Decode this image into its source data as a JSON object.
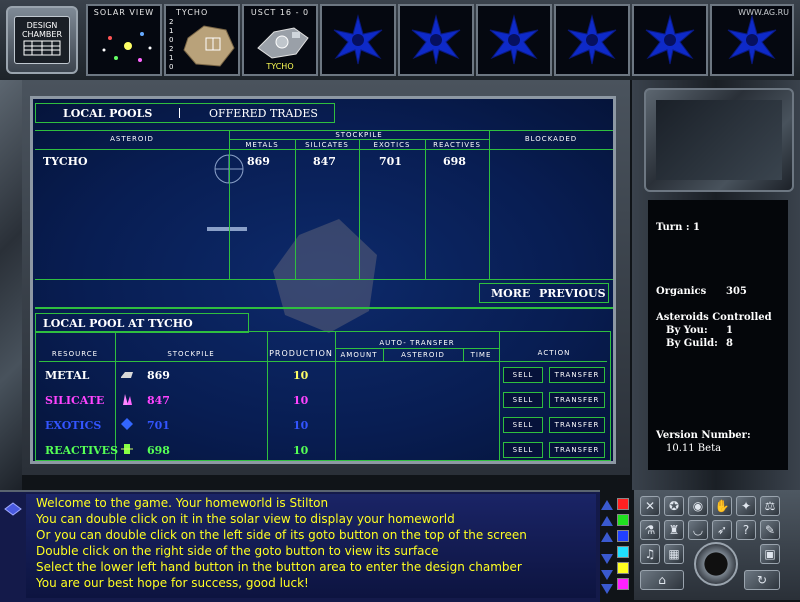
{
  "watermark": "WWW.AG.RU",
  "top_bar": {
    "design_chamber": {
      "line1": "DESIGN",
      "line2": "CHAMBER"
    },
    "solar_view": {
      "label": "SOLAR VIEW"
    },
    "tycho_slot": {
      "label": "TYCHO",
      "side_digits": [
        "2",
        "1",
        "0",
        "2",
        "1",
        "0"
      ]
    },
    "usct_slot": {
      "label": "USCT 16 - 0",
      "sub": "TYCHO"
    },
    "empty_slot_count": 6
  },
  "upper_panel": {
    "tabs": {
      "local_pools": "LOCAL POOLS",
      "offered_trades": "OFFERED TRADES"
    },
    "headers": {
      "asteroid": "ASTEROID",
      "stockpile": "STOCKPILE",
      "metals": "METALS",
      "silicates": "SILICATES",
      "exotics": "EXOTICS",
      "reactives": "REACTIVES",
      "blockaded": "BLOCKADED"
    },
    "row": {
      "asteroid": "TYCHO",
      "metals": "869",
      "silicates": "847",
      "exotics": "701",
      "reactives": "698"
    },
    "more": "MORE",
    "previous": "PREVIOUS"
  },
  "lower_panel": {
    "title": "LOCAL POOL AT TYCHO",
    "headers": {
      "resource": "RESOURCE",
      "stockpile": "STOCKPILE",
      "production": "PRODUCTION",
      "auto_transfer": "AUTO- TRANSFER",
      "amount": "AMOUNT",
      "asteroid": "ASTEROID",
      "time": "TIME",
      "action": "ACTION"
    },
    "sell_label": "SELL",
    "transfer_label": "TRANSFER",
    "rows": [
      {
        "resource": "METAL",
        "stockpile": "869",
        "production": "10",
        "color": "#ffffff"
      },
      {
        "resource": "SILICATE",
        "stockpile": "847",
        "production": "10",
        "color": "#ff44ff"
      },
      {
        "resource": "EXOTICS",
        "stockpile": "701",
        "production": "10",
        "color": "#3355ff"
      },
      {
        "resource": "REACTIVES",
        "stockpile": "698",
        "production": "10",
        "color": "#55ff55"
      }
    ]
  },
  "info_panel": {
    "turn": "Turn : 1",
    "organics_label": "Organics",
    "organics_value": "305",
    "asteroids_controlled": "Asteroids Controlled",
    "by_you_label": "By You:",
    "by_you_value": "1",
    "by_guild_label": "By Guild:",
    "by_guild_value": "8",
    "version_label": "Version Number:",
    "version_value": "10.11 Beta"
  },
  "messages": [
    "Welcome to the game. Your homeworld is Stilton",
    "You can double click on it in the solar view to display your homeworld",
    "Or you can double click on the left side of its goto button on the top of the screen",
    "Double click on the right side of the goto button to view its surface",
    "Select the lower left hand button in the button area to enter the design chamber",
    "You are our best hope for success, good luck!"
  ],
  "colors": {
    "grid": "#2fbf3f",
    "message_text": "#ffff22",
    "swatches": [
      "#ff2020",
      "#20e020",
      "#2040ff",
      "#20e0ff",
      "#ffff20",
      "#ff20ff"
    ]
  },
  "icons": [
    "close-icon",
    "medal-icon",
    "eye-icon",
    "hand-icon",
    "lightbulb-icon",
    "scale-icon",
    "flask-icon",
    "guild-icon",
    "lips-icon",
    "rocket-icon",
    "question-icon",
    "pencil-icon",
    "music-icon",
    "grid-icon",
    "globe-icon",
    "disk-icon",
    "factory-icon",
    "cycle-icon"
  ]
}
